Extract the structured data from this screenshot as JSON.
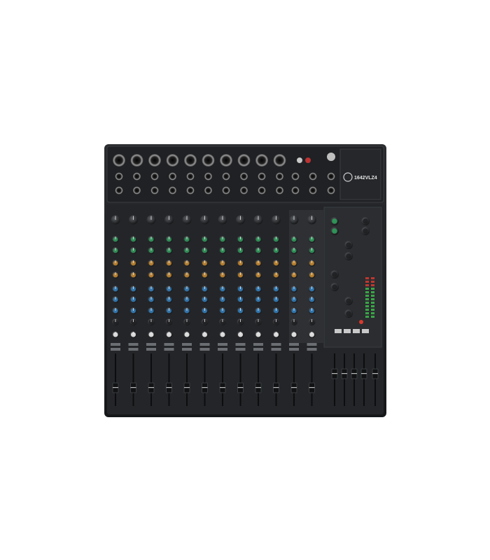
{
  "product": {
    "model_label": "1642VLZ4",
    "brand_mark": "MACKIE."
  },
  "channels": {
    "mono_count": 8,
    "stereo_count": 4
  },
  "colors": {
    "chassis": "#1b1d1f",
    "panel": "#2a2c2f",
    "gain_knob": "#1e1f21",
    "eq_high": "#2e9b5a",
    "eq_mid": "#c98a2c",
    "aux": "#2f7fbf",
    "pan": "#d9d9d9",
    "led_green": "#3dbb4a",
    "led_red": "#d83a2e",
    "fader_cap": "#111213"
  }
}
